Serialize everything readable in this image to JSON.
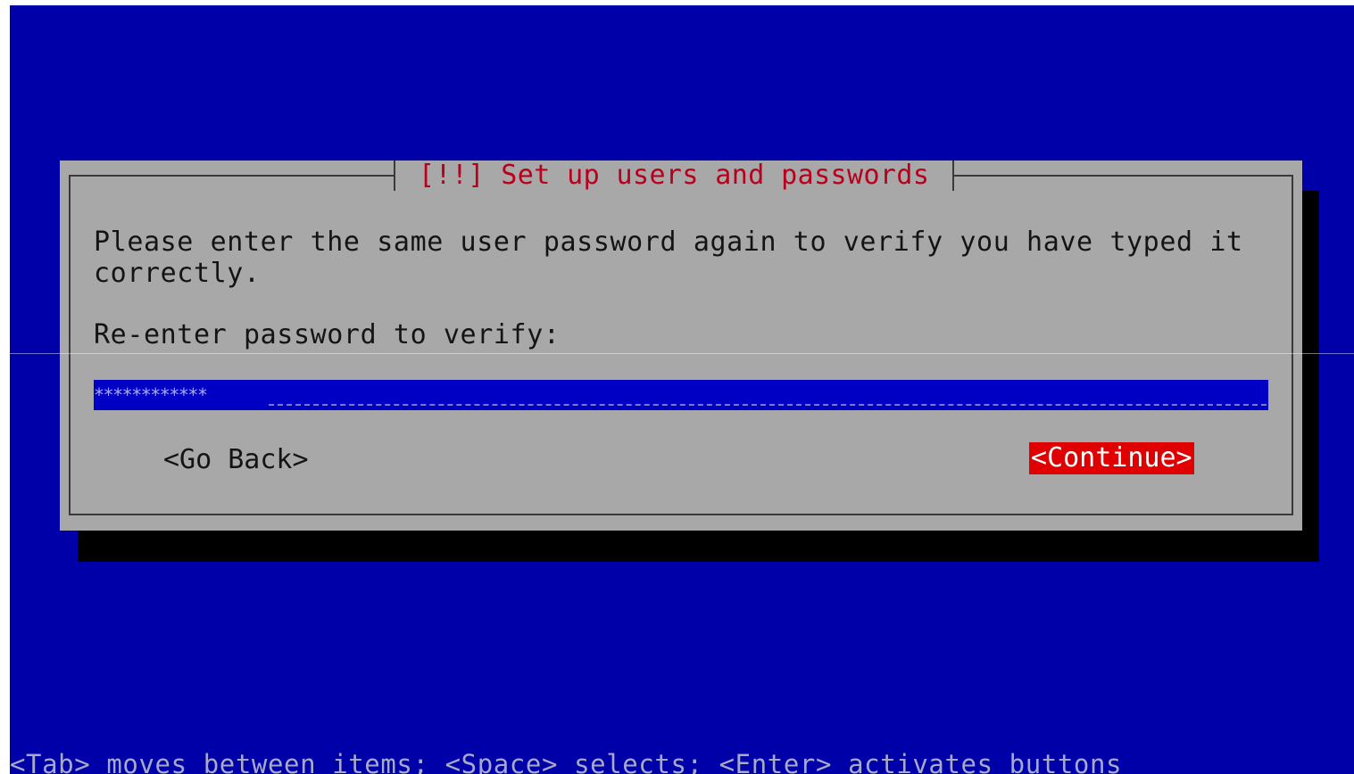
{
  "dialog": {
    "title": "[!!] Set up users and passwords",
    "message_line1": "Please enter the same user password again to verify you have typed it",
    "message_line2": "correctly.",
    "field_label": "Re-enter password to verify:",
    "password_value": "************",
    "buttons": {
      "go_back": "<Go Back>",
      "continue": "<Continue>"
    }
  },
  "help": {
    "text": "<Tab> moves between items; <Space> selects; <Enter> activates buttons"
  },
  "colors": {
    "background": "#0000a8",
    "dialog": "#a8a8a8",
    "title_text": "#b8001c",
    "input_field": "#0000c4",
    "selected_button": "#e00000"
  }
}
